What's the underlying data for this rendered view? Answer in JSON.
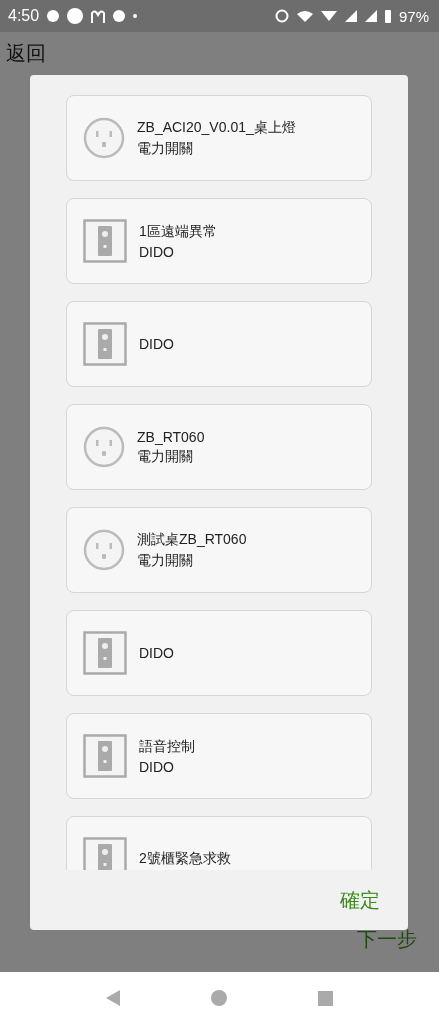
{
  "status_bar": {
    "time": "4:50",
    "battery": "97%"
  },
  "page": {
    "back": "返回",
    "next": "下一步"
  },
  "dialog": {
    "devices": [
      {
        "kind": "outlet",
        "name": "ZB_ACI20_V0.01_桌上燈",
        "type": "電力開關"
      },
      {
        "kind": "dido",
        "name": "1區遠端異常",
        "type": "DIDO"
      },
      {
        "kind": "dido",
        "name": "DIDO"
      },
      {
        "kind": "outlet",
        "name": "ZB_RT060",
        "type": "電力開關"
      },
      {
        "kind": "outlet",
        "name": "測試桌ZB_RT060",
        "type": "電力開關"
      },
      {
        "kind": "dido",
        "name": "DIDO"
      },
      {
        "kind": "dido",
        "name": "語音控制",
        "type": "DIDO"
      },
      {
        "kind": "dido",
        "name": "2號櫃緊急求救"
      }
    ],
    "confirm": "確定"
  }
}
